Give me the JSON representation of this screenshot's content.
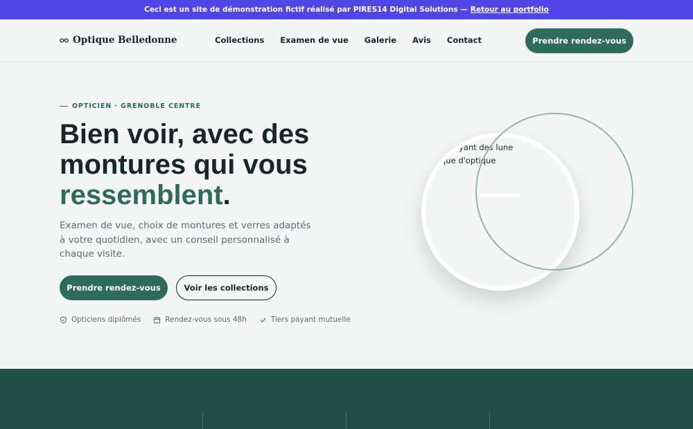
{
  "banner": {
    "text": "Ceci est un site de démonstration fictif réalisé par PIRES14 Digital Solutions —",
    "link": "Retour au portfolio"
  },
  "header": {
    "brand": "Optique Belledonne",
    "nav": [
      "Collections",
      "Examen de vue",
      "Galerie",
      "Avis",
      "Contact"
    ],
    "cta": "Prendre rendez-vous"
  },
  "hero": {
    "eyebrow": "OPTICIEN · GRENOBLE CENTRE",
    "title_line1": "Bien voir, avec des",
    "title_line2": "montures qui vous",
    "title_accent": "ressemblent",
    "title_end": ".",
    "description": "Examen de vue, choix de montures et verres adaptés à votre quotidien, avec un conseil personnalisé à chaque visite.",
    "primary_button": "Prendre rendez-vous",
    "secondary_button": "Voir les collections",
    "features": [
      {
        "icon": "shield-check-icon",
        "label": "Opticiens diplômés"
      },
      {
        "icon": "calendar-icon",
        "label": "Rendez-vous sous 48h"
      },
      {
        "icon": "check-icon",
        "label": "Tiers payant mutuelle"
      }
    ]
  },
  "illustration": {
    "line1": "essayant des lune",
    "line2": "que d'optique"
  },
  "colors": {
    "accent": "#2e6b5b",
    "banner": "#5046e5",
    "dark_band": "#214f46"
  }
}
